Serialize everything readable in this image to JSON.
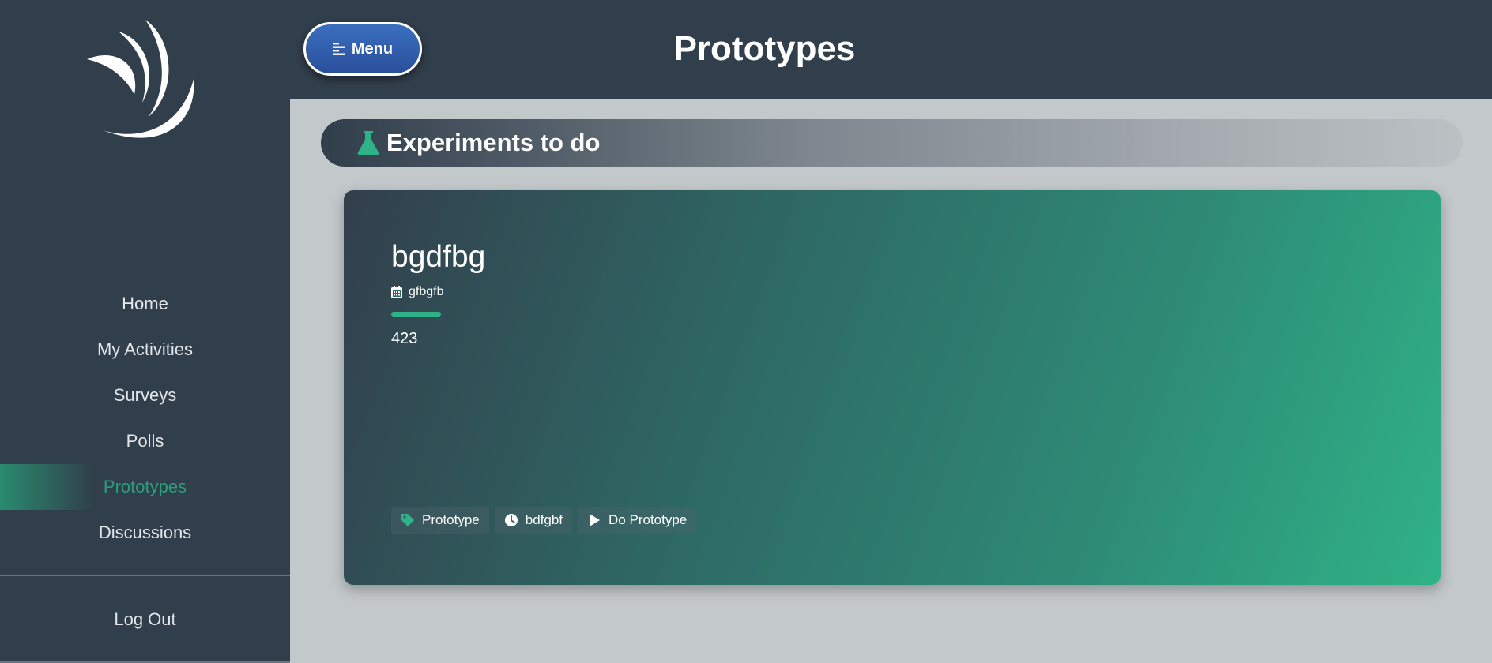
{
  "colors": {
    "sidebar_bg": "#313e4b",
    "accent_green": "#2fb287",
    "menu_button_blue": "#2a4f9a",
    "content_bg": "#c3c8cb"
  },
  "sidebar": {
    "logo_icon": "swoosh-logo",
    "items": [
      {
        "label": "Home"
      },
      {
        "label": "My Activities"
      },
      {
        "label": "Surveys"
      },
      {
        "label": "Polls"
      },
      {
        "label": "Prototypes",
        "active": true
      },
      {
        "label": "Discussions"
      }
    ],
    "logout_label": "Log Out"
  },
  "header": {
    "menu_label": "Menu",
    "menu_icon": "align-left-icon",
    "title": "Prototypes"
  },
  "section": {
    "icon": "flask-icon",
    "title": "Experiments to do"
  },
  "card": {
    "title": "bgdfbg",
    "date_icon": "calendar-icon",
    "date": "gfbgfb",
    "value": "423",
    "chips": [
      {
        "icon": "tag-icon",
        "label": "Prototype"
      },
      {
        "icon": "clock-icon",
        "label": "bdfgbf"
      },
      {
        "icon": "play-icon",
        "label": "Do Prototype"
      }
    ]
  }
}
